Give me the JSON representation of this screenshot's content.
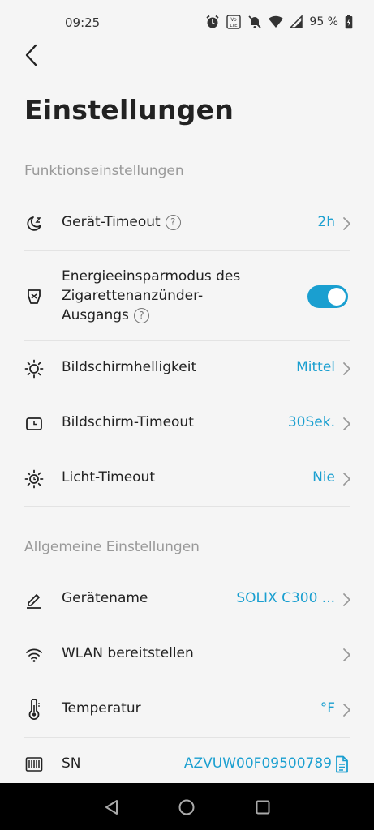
{
  "status_bar": {
    "time": "09:25",
    "battery": "95 %",
    "icons": [
      "alarm-icon",
      "volte-icon",
      "mute-icon",
      "wifi-icon",
      "signal-icon",
      "battery-icon"
    ]
  },
  "header": {
    "back_icon": "chevron-left-icon",
    "title": "Einstellungen"
  },
  "sections": {
    "function": {
      "title": "Funktionseinstellungen",
      "items": [
        {
          "label": "Gerät-Timeout",
          "value": "2h",
          "icon": "moon-icon",
          "help": "?"
        },
        {
          "label_lines": [
            "Energieeinsparmodus des",
            "Zigarettenanzünder-",
            "Ausgangs"
          ],
          "icon": "socket-icon",
          "toggle": true,
          "help": "?"
        },
        {
          "label": "Bildschirmhelligkeit",
          "value": "Mittel",
          "icon": "sun-icon"
        },
        {
          "label": "Bildschirm-Timeout",
          "value": "30Sek.",
          "icon": "screen-clock-icon"
        },
        {
          "label": "Licht-Timeout",
          "value": "Nie",
          "icon": "light-timeout-icon"
        }
      ]
    },
    "general": {
      "title": "Allgemeine Einstellungen",
      "items": [
        {
          "label": "Gerätename",
          "value": "SOLIX C300 ...",
          "icon": "pencil-icon"
        },
        {
          "label": "WLAN bereitstellen",
          "value": "",
          "icon": "wifi-icon"
        },
        {
          "label": "Temperatur",
          "value": "°F",
          "icon": "thermometer-icon"
        },
        {
          "label": "SN",
          "value": "AZVUW00F09500789",
          "icon": "barcode-icon",
          "action_icon": "copy-icon"
        }
      ]
    }
  },
  "colors": {
    "accent": "#1a9fd0",
    "background": "#f5f5f5",
    "text": "#222222",
    "muted": "#999999"
  }
}
